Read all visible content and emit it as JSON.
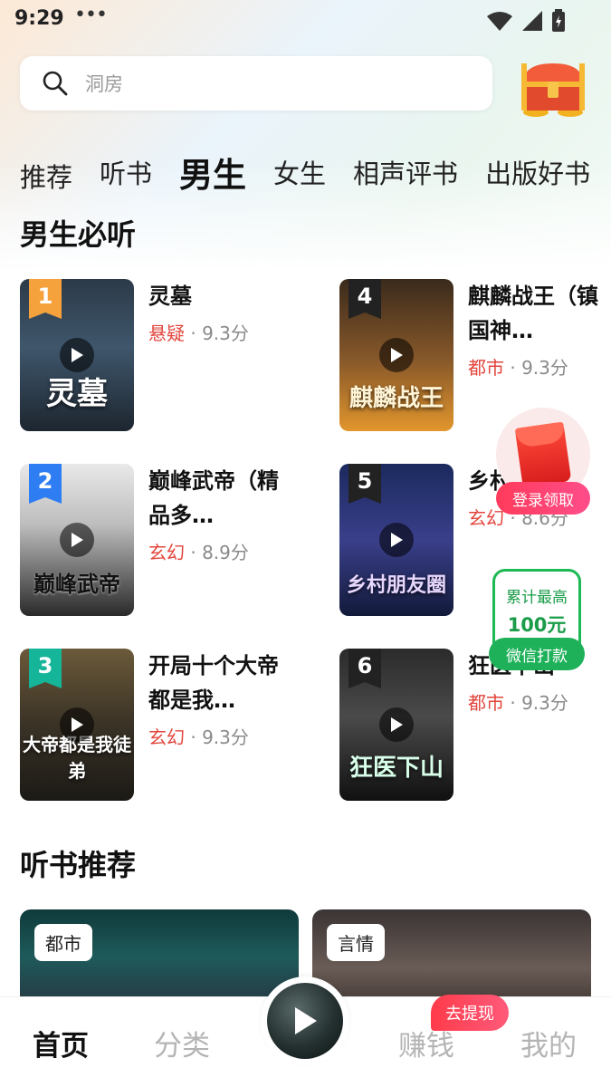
{
  "status_bar": {
    "time": "9:29",
    "dots": "•••"
  },
  "search": {
    "placeholder": "洞房"
  },
  "tabs": [
    "推荐",
    "听书",
    "男生",
    "女生",
    "相声评书",
    "出版好书"
  ],
  "active_tab": "男生",
  "section1": {
    "title": "男生必听"
  },
  "books": [
    {
      "rank": "1",
      "title": "灵墓",
      "genre": "悬疑",
      "score": " · 9.3分",
      "cover_title": "灵墓",
      "rank_color": "#f5a23c"
    },
    {
      "rank": "2",
      "title": "巅峰武帝（精品多…",
      "genre": "玄幻",
      "score": " · 8.9分",
      "cover_title": "巅峰武帝",
      "rank_color": "#2f7df3"
    },
    {
      "rank": "3",
      "title": "开局十个大帝都是我…",
      "genre": "玄幻",
      "score": " · 9.3分",
      "cover_title": "大帝都是我徒弟",
      "rank_color": "#15b59a"
    },
    {
      "rank": "4",
      "title": "麒麟战王（镇国神…",
      "genre": "都市",
      "score": " · 9.3分",
      "cover_title": "麒麟战王",
      "rank_color": "#222222"
    },
    {
      "rank": "5",
      "title": "乡村…",
      "genre": "玄幻",
      "score": " · 8.6分",
      "cover_title": "乡村朋友圈",
      "rank_color": "#222222"
    },
    {
      "rank": "6",
      "title": "狂医下山",
      "genre": "都市",
      "score": " · 9.3分",
      "cover_title": "狂医下山",
      "rank_color": "#222222"
    }
  ],
  "floating": {
    "login_label": "登录领取",
    "wechat_line1": "累计最高",
    "wechat_line2": "100元",
    "wechat_button": "微信打款"
  },
  "section2": {
    "title": "听书推荐"
  },
  "rec_cards": [
    {
      "tag": "都市"
    },
    {
      "tag": "言情"
    }
  ],
  "bottom_nav": {
    "home": "首页",
    "category": "分类",
    "earn": "赚钱",
    "mine": "我的",
    "withdraw_badge": "去提现"
  }
}
